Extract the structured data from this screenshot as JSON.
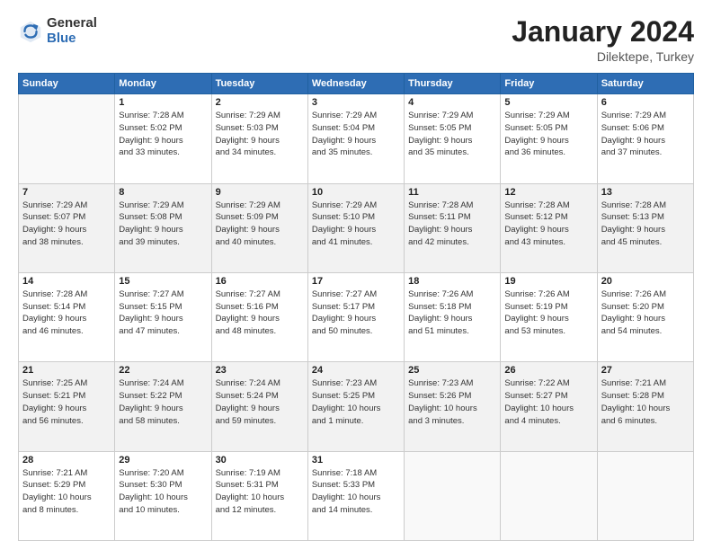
{
  "header": {
    "logo_general": "General",
    "logo_blue": "Blue",
    "title": "January 2024",
    "location": "Dilektepe, Turkey"
  },
  "days_of_week": [
    "Sunday",
    "Monday",
    "Tuesday",
    "Wednesday",
    "Thursday",
    "Friday",
    "Saturday"
  ],
  "weeks": [
    [
      {
        "day": "",
        "info": ""
      },
      {
        "day": "1",
        "info": "Sunrise: 7:28 AM\nSunset: 5:02 PM\nDaylight: 9 hours\nand 33 minutes."
      },
      {
        "day": "2",
        "info": "Sunrise: 7:29 AM\nSunset: 5:03 PM\nDaylight: 9 hours\nand 34 minutes."
      },
      {
        "day": "3",
        "info": "Sunrise: 7:29 AM\nSunset: 5:04 PM\nDaylight: 9 hours\nand 35 minutes."
      },
      {
        "day": "4",
        "info": "Sunrise: 7:29 AM\nSunset: 5:05 PM\nDaylight: 9 hours\nand 35 minutes."
      },
      {
        "day": "5",
        "info": "Sunrise: 7:29 AM\nSunset: 5:05 PM\nDaylight: 9 hours\nand 36 minutes."
      },
      {
        "day": "6",
        "info": "Sunrise: 7:29 AM\nSunset: 5:06 PM\nDaylight: 9 hours\nand 37 minutes."
      }
    ],
    [
      {
        "day": "7",
        "info": "Sunrise: 7:29 AM\nSunset: 5:07 PM\nDaylight: 9 hours\nand 38 minutes."
      },
      {
        "day": "8",
        "info": "Sunrise: 7:29 AM\nSunset: 5:08 PM\nDaylight: 9 hours\nand 39 minutes."
      },
      {
        "day": "9",
        "info": "Sunrise: 7:29 AM\nSunset: 5:09 PM\nDaylight: 9 hours\nand 40 minutes."
      },
      {
        "day": "10",
        "info": "Sunrise: 7:29 AM\nSunset: 5:10 PM\nDaylight: 9 hours\nand 41 minutes."
      },
      {
        "day": "11",
        "info": "Sunrise: 7:28 AM\nSunset: 5:11 PM\nDaylight: 9 hours\nand 42 minutes."
      },
      {
        "day": "12",
        "info": "Sunrise: 7:28 AM\nSunset: 5:12 PM\nDaylight: 9 hours\nand 43 minutes."
      },
      {
        "day": "13",
        "info": "Sunrise: 7:28 AM\nSunset: 5:13 PM\nDaylight: 9 hours\nand 45 minutes."
      }
    ],
    [
      {
        "day": "14",
        "info": "Sunrise: 7:28 AM\nSunset: 5:14 PM\nDaylight: 9 hours\nand 46 minutes."
      },
      {
        "day": "15",
        "info": "Sunrise: 7:27 AM\nSunset: 5:15 PM\nDaylight: 9 hours\nand 47 minutes."
      },
      {
        "day": "16",
        "info": "Sunrise: 7:27 AM\nSunset: 5:16 PM\nDaylight: 9 hours\nand 48 minutes."
      },
      {
        "day": "17",
        "info": "Sunrise: 7:27 AM\nSunset: 5:17 PM\nDaylight: 9 hours\nand 50 minutes."
      },
      {
        "day": "18",
        "info": "Sunrise: 7:26 AM\nSunset: 5:18 PM\nDaylight: 9 hours\nand 51 minutes."
      },
      {
        "day": "19",
        "info": "Sunrise: 7:26 AM\nSunset: 5:19 PM\nDaylight: 9 hours\nand 53 minutes."
      },
      {
        "day": "20",
        "info": "Sunrise: 7:26 AM\nSunset: 5:20 PM\nDaylight: 9 hours\nand 54 minutes."
      }
    ],
    [
      {
        "day": "21",
        "info": "Sunrise: 7:25 AM\nSunset: 5:21 PM\nDaylight: 9 hours\nand 56 minutes."
      },
      {
        "day": "22",
        "info": "Sunrise: 7:24 AM\nSunset: 5:22 PM\nDaylight: 9 hours\nand 58 minutes."
      },
      {
        "day": "23",
        "info": "Sunrise: 7:24 AM\nSunset: 5:24 PM\nDaylight: 9 hours\nand 59 minutes."
      },
      {
        "day": "24",
        "info": "Sunrise: 7:23 AM\nSunset: 5:25 PM\nDaylight: 10 hours\nand 1 minute."
      },
      {
        "day": "25",
        "info": "Sunrise: 7:23 AM\nSunset: 5:26 PM\nDaylight: 10 hours\nand 3 minutes."
      },
      {
        "day": "26",
        "info": "Sunrise: 7:22 AM\nSunset: 5:27 PM\nDaylight: 10 hours\nand 4 minutes."
      },
      {
        "day": "27",
        "info": "Sunrise: 7:21 AM\nSunset: 5:28 PM\nDaylight: 10 hours\nand 6 minutes."
      }
    ],
    [
      {
        "day": "28",
        "info": "Sunrise: 7:21 AM\nSunset: 5:29 PM\nDaylight: 10 hours\nand 8 minutes."
      },
      {
        "day": "29",
        "info": "Sunrise: 7:20 AM\nSunset: 5:30 PM\nDaylight: 10 hours\nand 10 minutes."
      },
      {
        "day": "30",
        "info": "Sunrise: 7:19 AM\nSunset: 5:31 PM\nDaylight: 10 hours\nand 12 minutes."
      },
      {
        "day": "31",
        "info": "Sunrise: 7:18 AM\nSunset: 5:33 PM\nDaylight: 10 hours\nand 14 minutes."
      },
      {
        "day": "",
        "info": ""
      },
      {
        "day": "",
        "info": ""
      },
      {
        "day": "",
        "info": ""
      }
    ]
  ]
}
